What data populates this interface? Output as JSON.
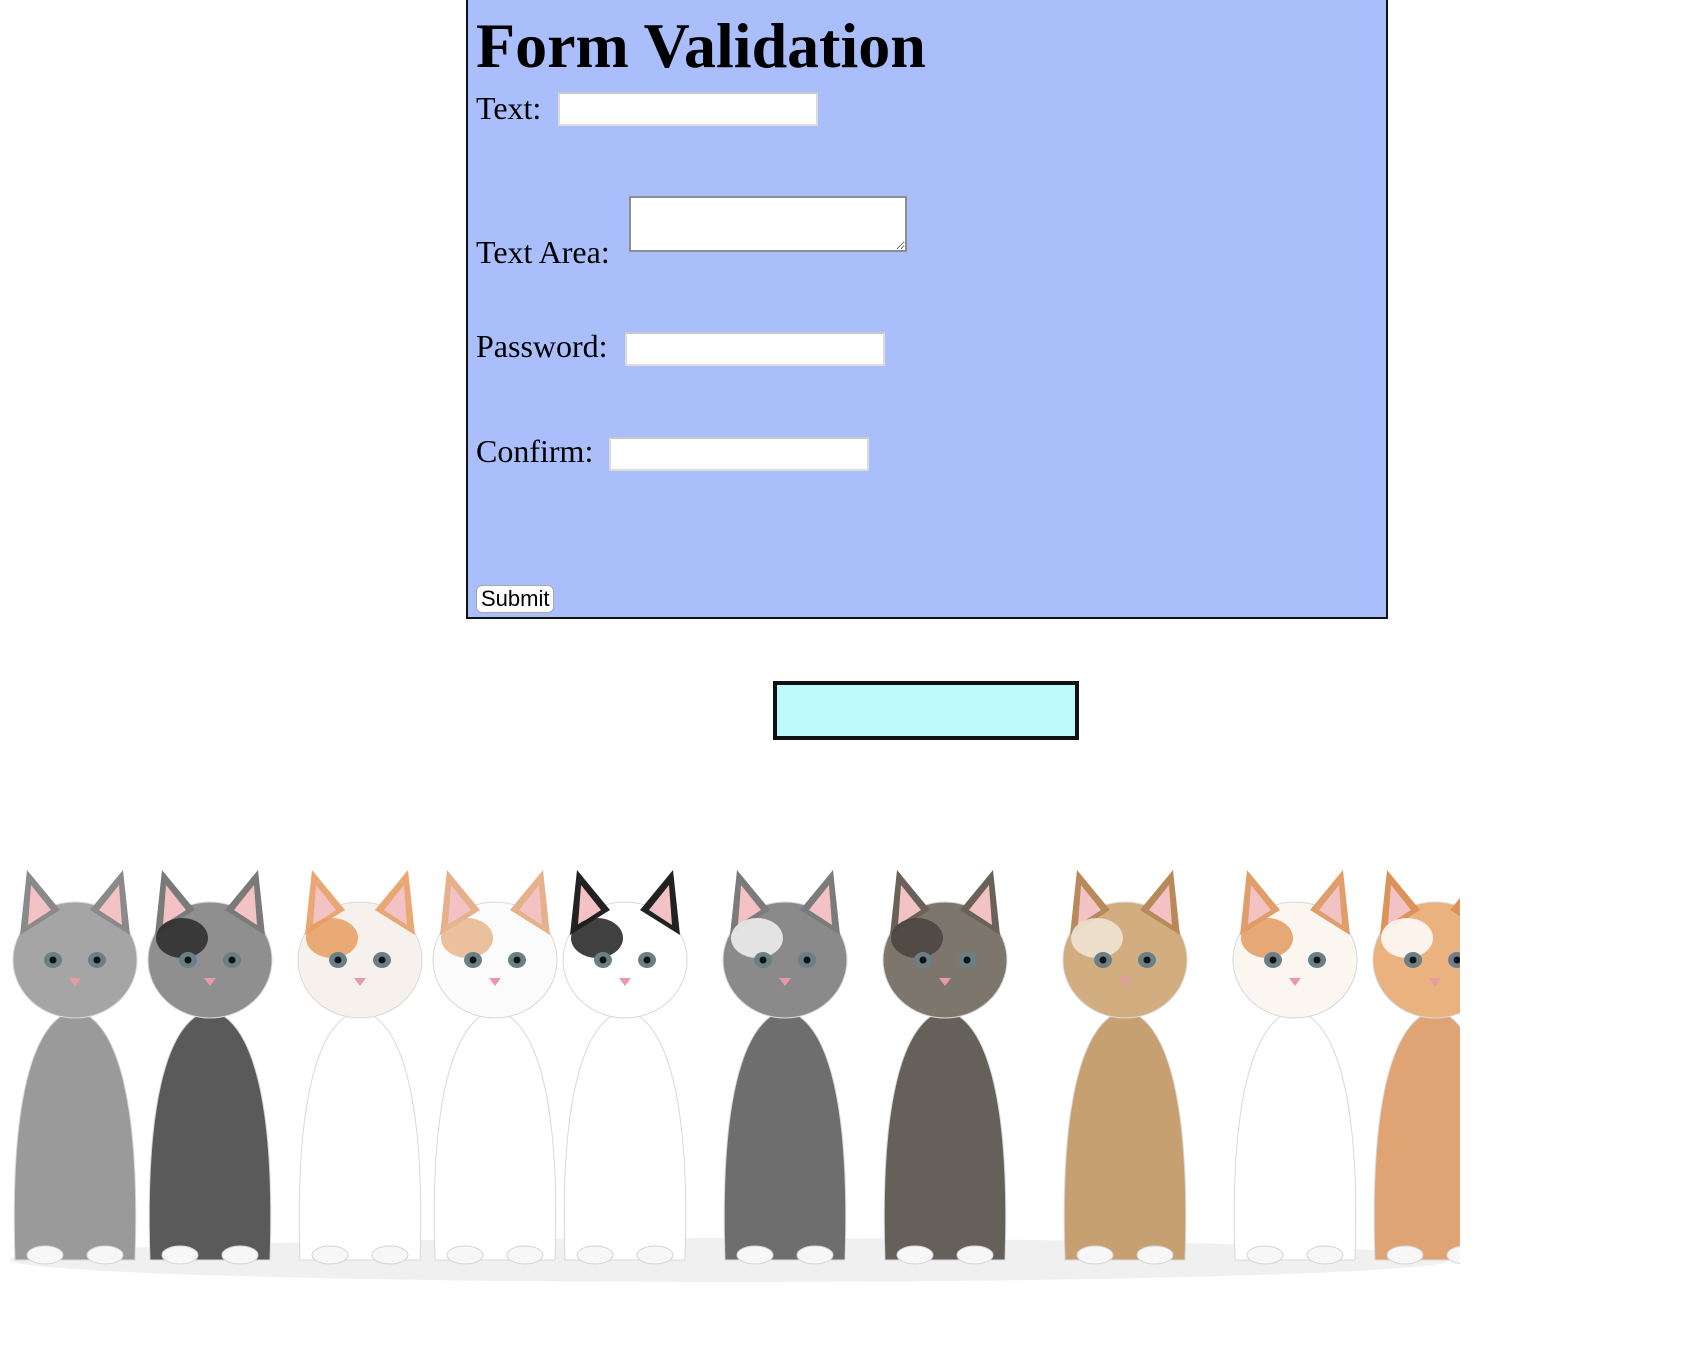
{
  "form": {
    "title": "Form Validation",
    "text_label": "Text:",
    "text_area_label": "Text Area:",
    "password_label": "Password:",
    "confirm_label": "Confirm:",
    "text_value": "",
    "text_area_value": "",
    "password_value": "",
    "confirm_value": "",
    "submit_label": "Submit"
  },
  "message": {
    "text": ""
  },
  "colors": {
    "form_background": "#a9befa",
    "message_background": "#bef9fb"
  },
  "image": {
    "subject": "row of kittens"
  }
}
